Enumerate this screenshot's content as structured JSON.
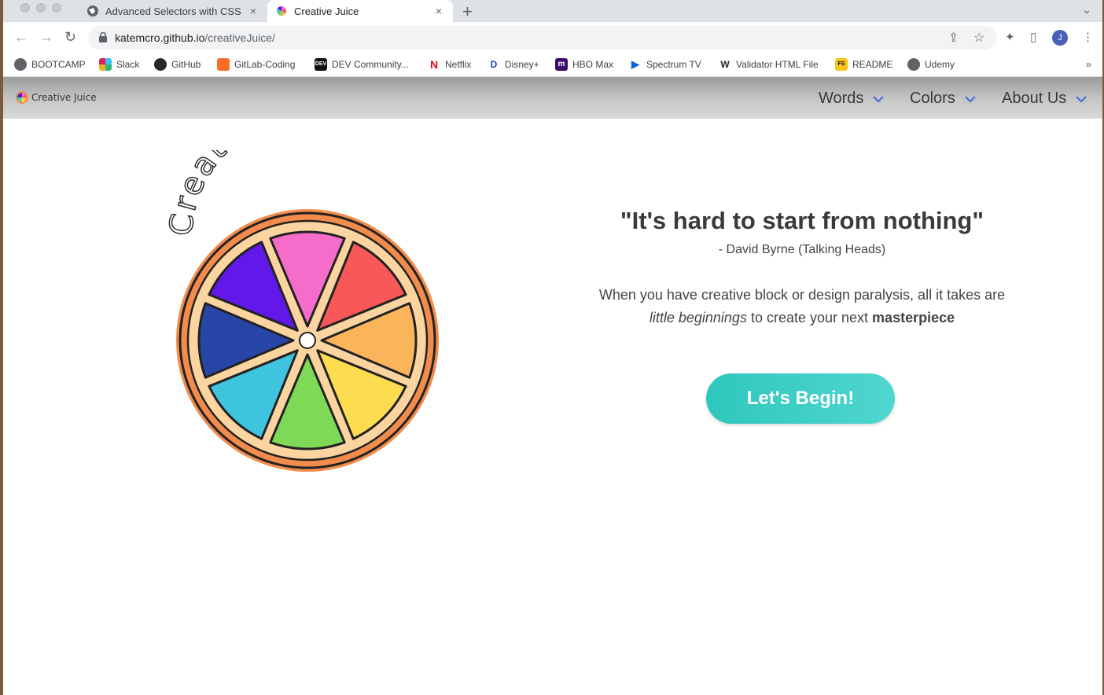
{
  "browser": {
    "tabs": [
      {
        "title": "Advanced Selectors with CSS",
        "close": "×"
      },
      {
        "title": "Creative Juice",
        "close": "×"
      }
    ],
    "new_tab": "+",
    "url_host": "katemcro.github.io",
    "url_path": "/creativeJuice/",
    "profile_initial": "J",
    "bookmarks": [
      "BOOTCAMP",
      "Slack",
      "GitHub",
      "GitLab-Coding",
      "DEV Community...",
      "Netflix",
      "Disney+",
      "HBO Max",
      "Spectrum TV",
      "Validator HTML File",
      "README",
      "Udemy"
    ],
    "bookmarks_more": "»"
  },
  "site": {
    "nav_logo": "Creative Juice",
    "menu": [
      "Words",
      "Colors",
      "About Us"
    ],
    "hero_logo_text": "Creative Juice",
    "quote": "\"It's hard to start from nothing\"",
    "author": "- David Byrne (Talking Heads)",
    "desc_part1": "When you have creative block or design paralysis, all it takes are ",
    "desc_em": "little beginnings",
    "desc_part2": " to create your next ",
    "desc_strong": "masterpiece",
    "cta": "Let's Begin!"
  },
  "colors": {
    "cta": "#2fc7bd",
    "menu_chevron": "#4a6fd6",
    "slices": [
      "#f66ccb",
      "#f85858",
      "#fab55a",
      "#fddd4f",
      "#7ed957",
      "#3fc4df",
      "#2846a8",
      "#6218e8"
    ],
    "rind": "#f28c4c"
  }
}
